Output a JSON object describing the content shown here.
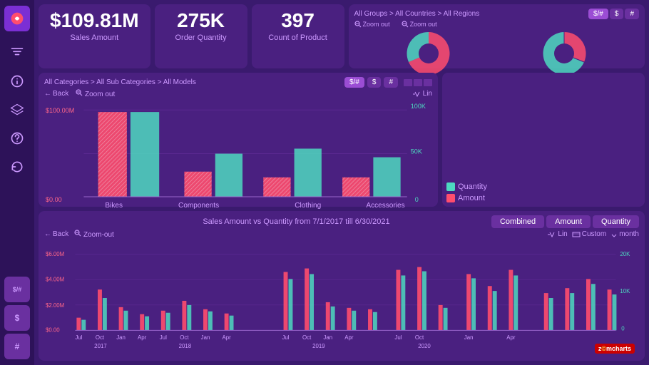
{
  "sidebar": {
    "items": [
      {
        "label": "logo",
        "icon": "grid-icon",
        "active": true
      },
      {
        "label": "filter",
        "icon": "filter-icon",
        "active": false
      },
      {
        "label": "info",
        "icon": "info-icon",
        "active": false
      },
      {
        "label": "layers",
        "icon": "layers-icon",
        "active": false
      },
      {
        "label": "help",
        "icon": "help-icon",
        "active": false
      },
      {
        "label": "refresh",
        "icon": "refresh-icon",
        "active": false
      },
      {
        "label": "dollar-hash-1",
        "icon": "dollar-hash-icon",
        "active": false
      },
      {
        "label": "dollar-1",
        "icon": "dollar-icon",
        "active": false
      },
      {
        "label": "hash-1",
        "icon": "hash-icon",
        "active": false
      }
    ]
  },
  "kpi": {
    "sales_amount": {
      "value": "$109.81M",
      "label": "Sales Amount"
    },
    "order_quantity": {
      "value": "275K",
      "label": "Order Quantity"
    },
    "count_of_product": {
      "value": "397",
      "label": "Count of Product"
    }
  },
  "pie_panel": {
    "breadcrumb": "All Groups > All Countries > All Regions",
    "buttons": [
      "$/# ",
      "$",
      "#"
    ],
    "zoom_out_1": "Zoom out",
    "zoom_out_2": "Zoom out"
  },
  "bar_chart": {
    "breadcrumb": "All Categories > All Sub Categories > All Models",
    "buttons": [
      "$/#",
      "$",
      "#"
    ],
    "back_label": "Back",
    "zoom_label": "Zoom out",
    "lin_label": "Lin",
    "categories": [
      "Bikes",
      "Components",
      "Clothing",
      "Accessories"
    ],
    "y_axis_labels": [
      "$100.00M",
      "$0.00"
    ],
    "y2_axis_labels": [
      "100K",
      "50K",
      "0"
    ]
  },
  "time_chart": {
    "title": "Sales Amount vs Quantity from  7/1/2017  till  6/30/2021",
    "buttons": [
      "Combined",
      "Amount",
      "Quantity"
    ],
    "active_button": "Combined",
    "back_label": "Back",
    "zoom_label": "Zoom-out",
    "lin_label": "Lin",
    "custom_label": "Custom",
    "month_label": "month",
    "y_axis_labels": [
      "$6.00M",
      "$4.00M",
      "$2.00M",
      "$0.00"
    ],
    "y2_axis_labels": [
      "20K",
      "10K",
      "0"
    ],
    "x_labels": [
      "Jul",
      "Oct",
      "Jan",
      "Apr",
      "Jul",
      "Oct",
      "Jan",
      "Apr",
      "Jul",
      "Oct",
      "Jan",
      "Apr",
      "Jul",
      "Oct",
      "Jan",
      "Apr"
    ],
    "year_labels": [
      "2017",
      "2018",
      "2019",
      "2020"
    ],
    "amount_color": "#ff4d6d",
    "quantity_color": "#4dd9c0"
  },
  "colors": {
    "accent_purple": "#7b2fd4",
    "bg_panel": "#4a2080",
    "bg_dark": "#2d1259",
    "text_light": "#cc99ff",
    "pink": "#ff4d6d",
    "teal": "#4dd9c0",
    "yellow": "#ffdd44"
  }
}
